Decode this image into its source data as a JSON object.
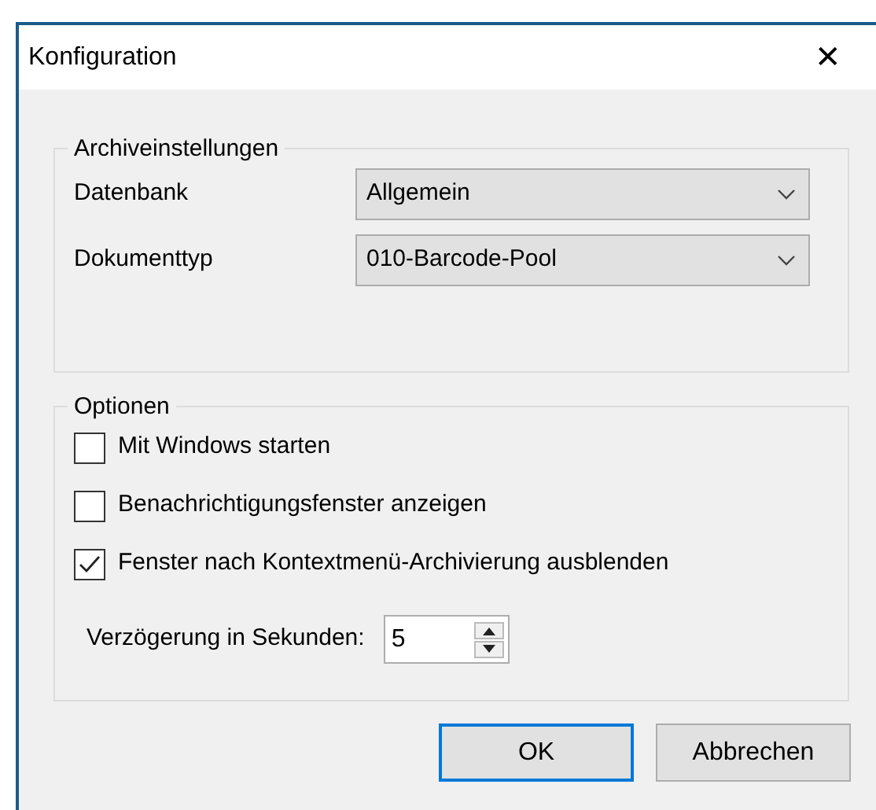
{
  "window": {
    "title": "Konfiguration",
    "close": "✕"
  },
  "archive_group": {
    "legend": "Archiveinstellungen",
    "fields": [
      {
        "label": "Datenbank",
        "value": "Allgemein"
      },
      {
        "label": "Dokumenttyp",
        "value": "010-Barcode-Pool"
      }
    ]
  },
  "options_group": {
    "legend": "Optionen",
    "checkboxes": [
      {
        "label": "Mit Windows starten",
        "checked": false
      },
      {
        "label": "Benachrichtigungsfenster anzeigen",
        "checked": false
      },
      {
        "label": "Fenster nach Kontextmenü-Archivierung ausblenden",
        "checked": true
      }
    ],
    "delay": {
      "label": "Verzögerung in Sekunden:",
      "value": "5"
    }
  },
  "buttons": [
    {
      "label": "OK",
      "default": true
    },
    {
      "label": "Abbrechen",
      "default": false
    }
  ]
}
